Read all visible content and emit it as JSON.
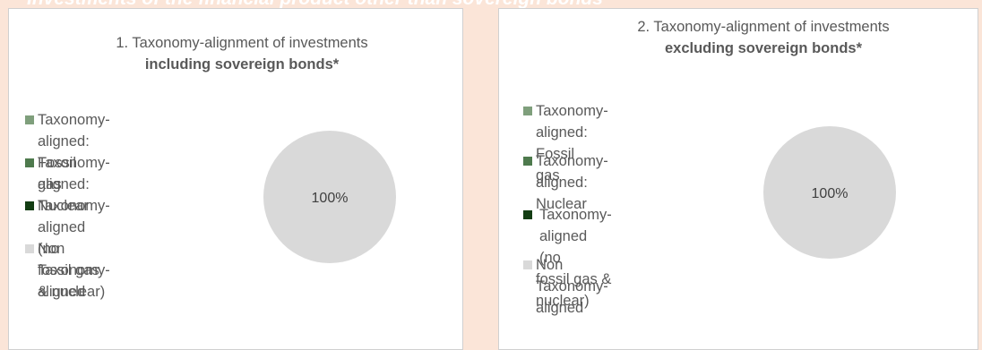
{
  "header": {
    "partial_text": "Investments of the financial product other than sovereign bonds"
  },
  "legend_colors": {
    "fossil_gas": "#7f9f7c",
    "nuclear": "#4e7a4d",
    "no_fossil_nuclear": "#133d13",
    "non_aligned": "#d9d9d9"
  },
  "chart_data": [
    {
      "type": "pie",
      "title": "1. Taxonomy-alignment of investments including sovereign bonds*",
      "title_line1": "1. Taxonomy-alignment of investments",
      "title_line2": "including sovereign bonds*",
      "categories": [
        "Taxonomy-aligned: Fossil gas",
        "Taxonomy-aligned: Nuclear",
        "Taxonomy-aligned (no fossil gas & nuclear)",
        "Non Taxonomy-aligned"
      ],
      "values": [
        0,
        0,
        0,
        100
      ],
      "data_labels": [
        "",
        "",
        "",
        "100%"
      ],
      "legend": [
        {
          "line1": "Taxonomy-aligned: Fossil",
          "line2": "gas"
        },
        {
          "line1": "Taxonomy-aligned:",
          "line2": "Nuclear"
        },
        {
          "line1": "Taxonomy-aligned (no",
          "line2": "fossil gas & nuclear)"
        },
        {
          "line1": "Non Taxonomy-aligned",
          "line2": ""
        }
      ],
      "legend_position": "left"
    },
    {
      "type": "pie",
      "title": "2. Taxonomy-alignment of investments excluding sovereign bonds*",
      "title_line1": "2. Taxonomy-alignment of investments",
      "title_line2": "excluding sovereign bonds*",
      "categories": [
        "Taxonomy-aligned: Fossil gas",
        "Taxonomy-aligned: Nuclear",
        "Taxonomy-aligned (no fossil gas & nuclear)",
        "Non Taxonomy-aligned"
      ],
      "values": [
        0,
        0,
        0,
        100
      ],
      "data_labels": [
        "",
        "",
        "",
        "100%"
      ],
      "legend": [
        {
          "line1": "Taxonomy-aligned: Fossil",
          "line2": "gas"
        },
        {
          "line1": "Taxonomy-aligned: Nuclear",
          "line2": ""
        },
        {
          "line1": "Taxonomy-aligned (no",
          "line2": "fossil gas & nuclear)"
        },
        {
          "line1": "Non Taxonomy-aligned",
          "line2": ""
        }
      ],
      "legend_position": "left"
    }
  ]
}
